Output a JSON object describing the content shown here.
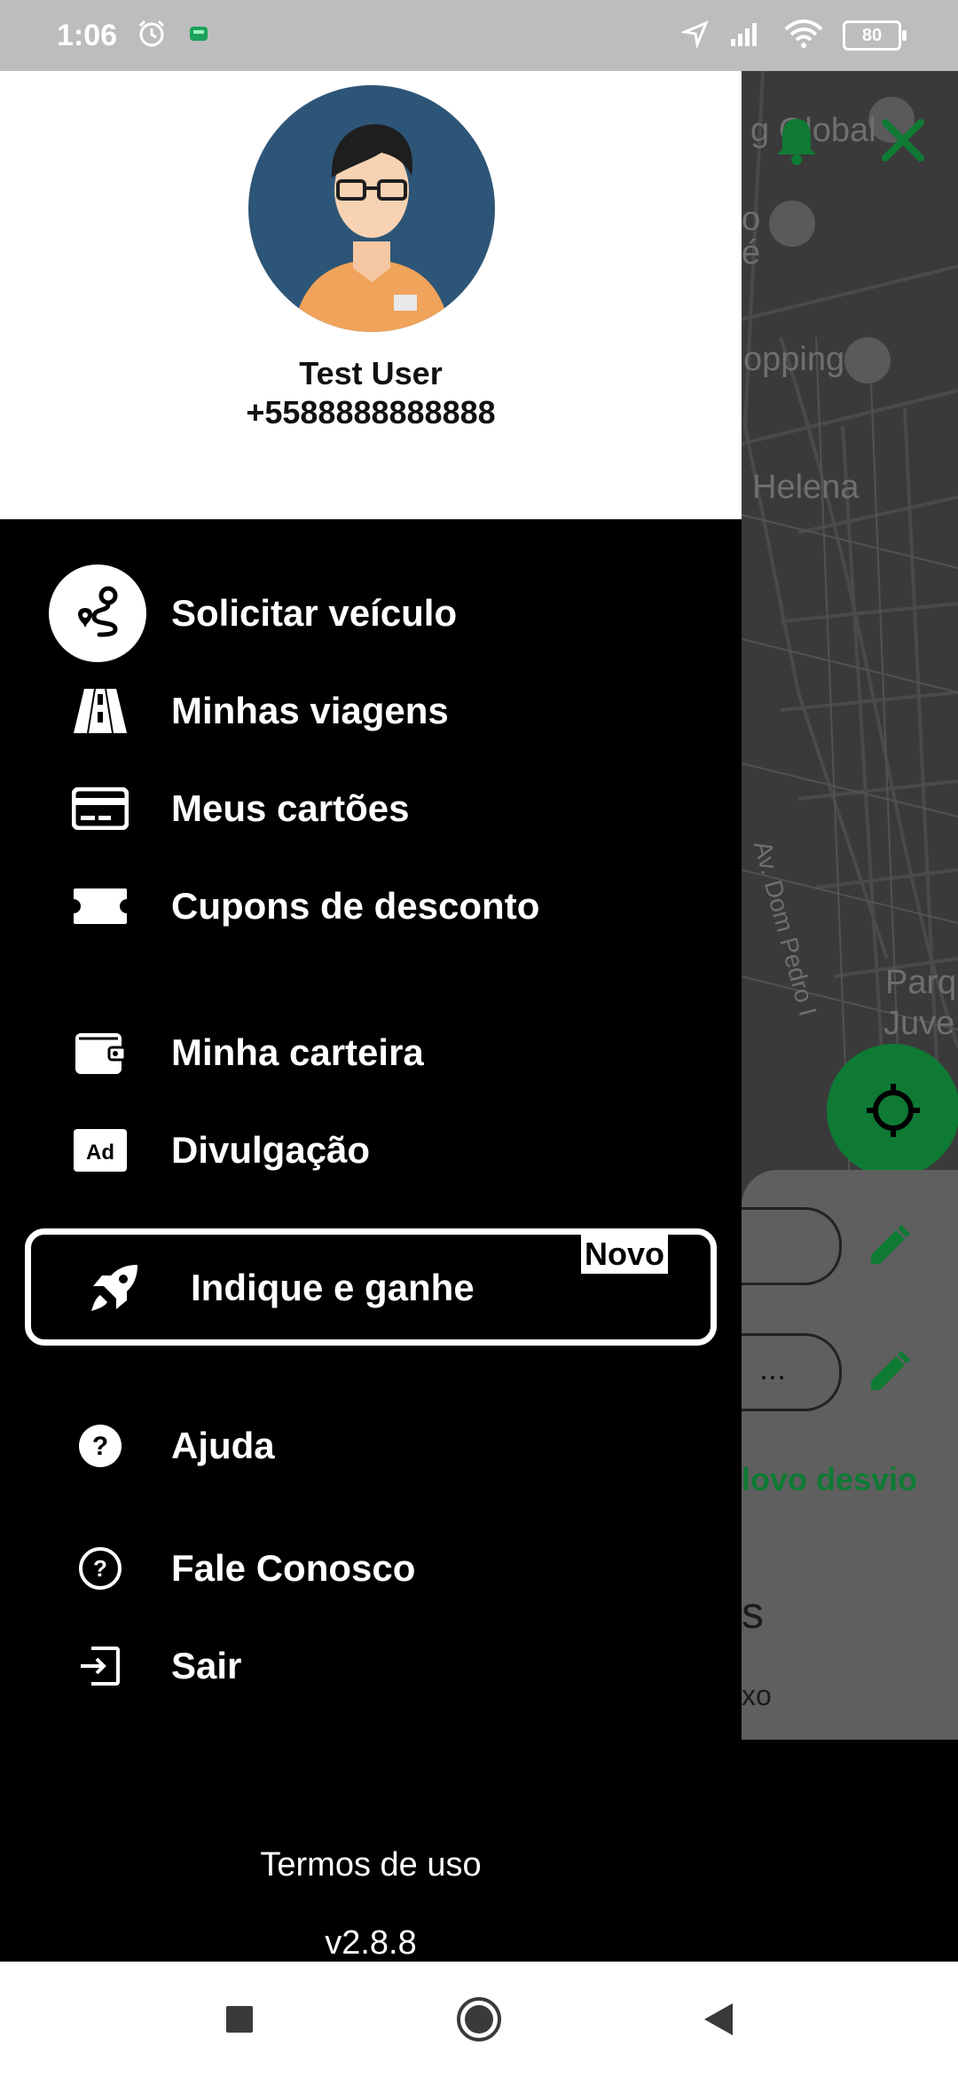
{
  "status_bar": {
    "time": "1:06",
    "battery": "80",
    "icons": [
      "alarm-icon",
      "app-notification-icon",
      "location-arrow-icon",
      "signal-icon",
      "wifi-icon",
      "battery-icon"
    ]
  },
  "map": {
    "labels": [
      "g Global",
      "o",
      "é",
      "opping",
      "Helena",
      "Av. Dom Pedro I",
      "Parq",
      "Juve"
    ],
    "accent_color": "#0f7a34"
  },
  "background_panel": {
    "field_1_text": "",
    "field_2_text": "...",
    "new_detour_label": "lovo desvio",
    "big_text": "s",
    "small_text": "xo"
  },
  "drawer": {
    "user": {
      "name": "Test User",
      "phone": "+5588888888888"
    },
    "menu": [
      {
        "label": "Solicitar veículo",
        "icon": "route-icon",
        "active": true
      },
      {
        "label": "Minhas viagens",
        "icon": "road-icon"
      },
      {
        "label": "Meus cartões",
        "icon": "credit-card-icon"
      },
      {
        "label": "Cupons de desconto",
        "icon": "ticket-icon"
      },
      {
        "label": "Minha carteira",
        "icon": "wallet-icon"
      },
      {
        "label": "Divulgação",
        "icon": "ad-icon"
      },
      {
        "label": "Indique e ganhe",
        "icon": "rocket-icon",
        "badge": "Novo"
      },
      {
        "label": "Ajuda",
        "icon": "help-filled-icon"
      },
      {
        "label": "Fale Conosco",
        "icon": "help-outline-icon"
      },
      {
        "label": "Sair",
        "icon": "logout-icon"
      }
    ],
    "terms_label": "Termos de uso",
    "version": "v2.8.8"
  },
  "nav_bar": {
    "buttons": [
      "recents-square-icon",
      "home-circle-icon",
      "back-triangle-icon"
    ]
  }
}
